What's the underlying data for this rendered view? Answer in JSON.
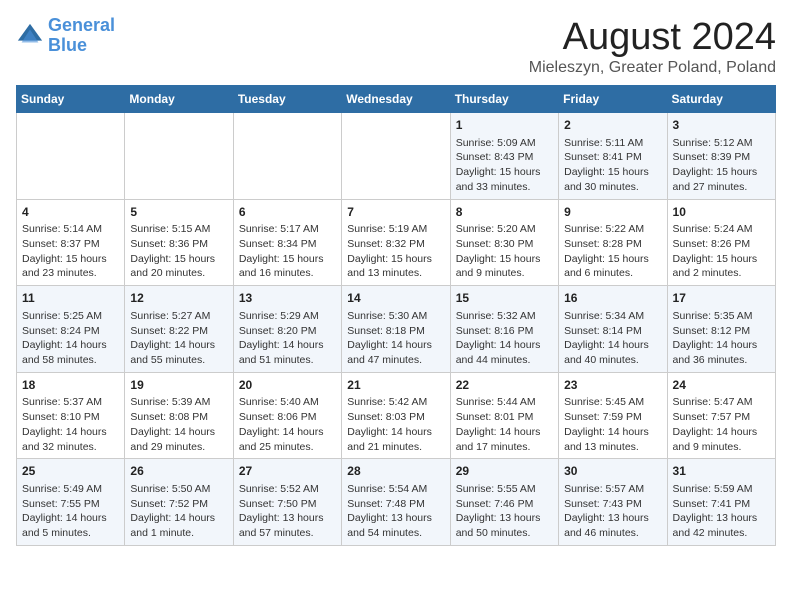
{
  "header": {
    "logo_line1": "General",
    "logo_line2": "Blue",
    "main_title": "August 2024",
    "subtitle": "Mieleszyn, Greater Poland, Poland"
  },
  "calendar": {
    "days_of_week": [
      "Sunday",
      "Monday",
      "Tuesday",
      "Wednesday",
      "Thursday",
      "Friday",
      "Saturday"
    ],
    "weeks": [
      [
        {
          "day": "",
          "info": ""
        },
        {
          "day": "",
          "info": ""
        },
        {
          "day": "",
          "info": ""
        },
        {
          "day": "",
          "info": ""
        },
        {
          "day": "1",
          "info": "Sunrise: 5:09 AM\nSunset: 8:43 PM\nDaylight: 15 hours\nand 33 minutes."
        },
        {
          "day": "2",
          "info": "Sunrise: 5:11 AM\nSunset: 8:41 PM\nDaylight: 15 hours\nand 30 minutes."
        },
        {
          "day": "3",
          "info": "Sunrise: 5:12 AM\nSunset: 8:39 PM\nDaylight: 15 hours\nand 27 minutes."
        }
      ],
      [
        {
          "day": "4",
          "info": "Sunrise: 5:14 AM\nSunset: 8:37 PM\nDaylight: 15 hours\nand 23 minutes."
        },
        {
          "day": "5",
          "info": "Sunrise: 5:15 AM\nSunset: 8:36 PM\nDaylight: 15 hours\nand 20 minutes."
        },
        {
          "day": "6",
          "info": "Sunrise: 5:17 AM\nSunset: 8:34 PM\nDaylight: 15 hours\nand 16 minutes."
        },
        {
          "day": "7",
          "info": "Sunrise: 5:19 AM\nSunset: 8:32 PM\nDaylight: 15 hours\nand 13 minutes."
        },
        {
          "day": "8",
          "info": "Sunrise: 5:20 AM\nSunset: 8:30 PM\nDaylight: 15 hours\nand 9 minutes."
        },
        {
          "day": "9",
          "info": "Sunrise: 5:22 AM\nSunset: 8:28 PM\nDaylight: 15 hours\nand 6 minutes."
        },
        {
          "day": "10",
          "info": "Sunrise: 5:24 AM\nSunset: 8:26 PM\nDaylight: 15 hours\nand 2 minutes."
        }
      ],
      [
        {
          "day": "11",
          "info": "Sunrise: 5:25 AM\nSunset: 8:24 PM\nDaylight: 14 hours\nand 58 minutes."
        },
        {
          "day": "12",
          "info": "Sunrise: 5:27 AM\nSunset: 8:22 PM\nDaylight: 14 hours\nand 55 minutes."
        },
        {
          "day": "13",
          "info": "Sunrise: 5:29 AM\nSunset: 8:20 PM\nDaylight: 14 hours\nand 51 minutes."
        },
        {
          "day": "14",
          "info": "Sunrise: 5:30 AM\nSunset: 8:18 PM\nDaylight: 14 hours\nand 47 minutes."
        },
        {
          "day": "15",
          "info": "Sunrise: 5:32 AM\nSunset: 8:16 PM\nDaylight: 14 hours\nand 44 minutes."
        },
        {
          "day": "16",
          "info": "Sunrise: 5:34 AM\nSunset: 8:14 PM\nDaylight: 14 hours\nand 40 minutes."
        },
        {
          "day": "17",
          "info": "Sunrise: 5:35 AM\nSunset: 8:12 PM\nDaylight: 14 hours\nand 36 minutes."
        }
      ],
      [
        {
          "day": "18",
          "info": "Sunrise: 5:37 AM\nSunset: 8:10 PM\nDaylight: 14 hours\nand 32 minutes."
        },
        {
          "day": "19",
          "info": "Sunrise: 5:39 AM\nSunset: 8:08 PM\nDaylight: 14 hours\nand 29 minutes."
        },
        {
          "day": "20",
          "info": "Sunrise: 5:40 AM\nSunset: 8:06 PM\nDaylight: 14 hours\nand 25 minutes."
        },
        {
          "day": "21",
          "info": "Sunrise: 5:42 AM\nSunset: 8:03 PM\nDaylight: 14 hours\nand 21 minutes."
        },
        {
          "day": "22",
          "info": "Sunrise: 5:44 AM\nSunset: 8:01 PM\nDaylight: 14 hours\nand 17 minutes."
        },
        {
          "day": "23",
          "info": "Sunrise: 5:45 AM\nSunset: 7:59 PM\nDaylight: 14 hours\nand 13 minutes."
        },
        {
          "day": "24",
          "info": "Sunrise: 5:47 AM\nSunset: 7:57 PM\nDaylight: 14 hours\nand 9 minutes."
        }
      ],
      [
        {
          "day": "25",
          "info": "Sunrise: 5:49 AM\nSunset: 7:55 PM\nDaylight: 14 hours\nand 5 minutes."
        },
        {
          "day": "26",
          "info": "Sunrise: 5:50 AM\nSunset: 7:52 PM\nDaylight: 14 hours\nand 1 minute."
        },
        {
          "day": "27",
          "info": "Sunrise: 5:52 AM\nSunset: 7:50 PM\nDaylight: 13 hours\nand 57 minutes."
        },
        {
          "day": "28",
          "info": "Sunrise: 5:54 AM\nSunset: 7:48 PM\nDaylight: 13 hours\nand 54 minutes."
        },
        {
          "day": "29",
          "info": "Sunrise: 5:55 AM\nSunset: 7:46 PM\nDaylight: 13 hours\nand 50 minutes."
        },
        {
          "day": "30",
          "info": "Sunrise: 5:57 AM\nSunset: 7:43 PM\nDaylight: 13 hours\nand 46 minutes."
        },
        {
          "day": "31",
          "info": "Sunrise: 5:59 AM\nSunset: 7:41 PM\nDaylight: 13 hours\nand 42 minutes."
        }
      ]
    ]
  }
}
